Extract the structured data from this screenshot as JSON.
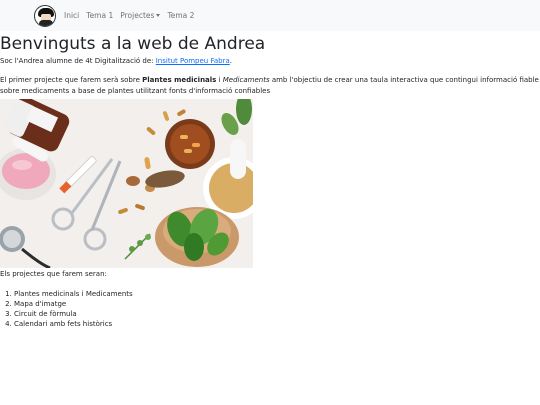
{
  "nav": {
    "links": [
      {
        "label": "Inici"
      },
      {
        "label": "Tema 1"
      },
      {
        "label": "Projectes"
      },
      {
        "label": "Tema 2"
      }
    ]
  },
  "page": {
    "title": "Benvinguts a la web de Andrea",
    "intro_prefix": "Soc l'Andrea alumne de 4t Digitalització de: ",
    "intro_link": "Insitut Pompeu Fabra",
    "intro_suffix": ".",
    "desc_1": "El primer projecte que farem serà sobre ",
    "desc_bold": "Plantes medicinals",
    "desc_2": " i ",
    "desc_italic": "Medicaments",
    "desc_3": " amb l'objectiu de crear una taula interactiva que contingui informació fiable sobre medicaments a base de plantes utilitzant fonts d'informació confiables",
    "list_title": "Els projectes que farem seran:",
    "projects": [
      "Plantes medicinals i Medicaments",
      "Mapa d'imatge",
      "Circuit de fòrmula",
      "Calendari amb fets històrics"
    ]
  }
}
